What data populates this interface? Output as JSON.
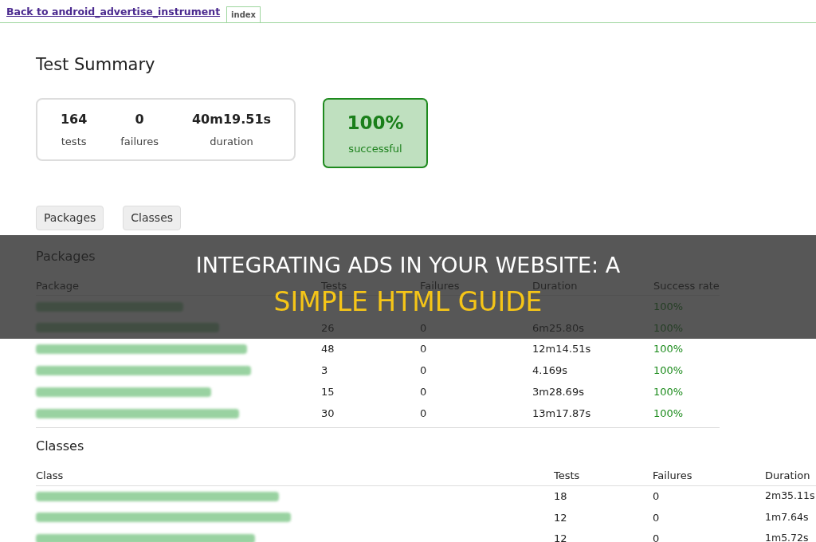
{
  "nav": {
    "back_link": "Back to android_advertise_instrument",
    "tabs": [
      {
        "label": "index",
        "selected": true
      }
    ]
  },
  "title": "Test Summary",
  "summary": {
    "stats": [
      {
        "value": "164",
        "label": "tests"
      },
      {
        "value": "0",
        "label": "failures"
      },
      {
        "value": "40m19.51s",
        "label": "duration"
      }
    ],
    "success": {
      "value": "100%",
      "label": "successful"
    }
  },
  "view_buttons": [
    "Packages",
    "Classes"
  ],
  "packages": {
    "heading": "Packages",
    "columns": [
      "Package",
      "Tests",
      "Failures",
      "Duration",
      "Success rate"
    ],
    "rows": [
      {
        "success_rate": "100%"
      },
      {
        "tests": "26",
        "failures": "0",
        "duration": "6m25.80s",
        "success_rate": "100%"
      },
      {
        "tests": "48",
        "failures": "0",
        "duration": "12m14.51s",
        "success_rate": "100%"
      },
      {
        "tests": "3",
        "failures": "0",
        "duration": "4.169s",
        "success_rate": "100%"
      },
      {
        "tests": "15",
        "failures": "0",
        "duration": "3m28.69s",
        "success_rate": "100%"
      },
      {
        "tests": "30",
        "failures": "0",
        "duration": "13m17.87s",
        "success_rate": "100%"
      }
    ]
  },
  "classes": {
    "heading": "Classes",
    "columns": [
      "Class",
      "Tests",
      "Failures",
      "Duration"
    ],
    "rows": [
      {
        "tests": "18",
        "failures": "0",
        "duration": "2m35.11s"
      },
      {
        "tests": "12",
        "failures": "0",
        "duration": "1m7.64s"
      },
      {
        "tests": "12",
        "failures": "0",
        "duration": "1m5.72s"
      }
    ]
  },
  "banner": {
    "line_1": "INTEGRATING ADS IN YOUR WEBSITE: A",
    "line_2": "SIMPLE HTML GUIDE"
  }
}
